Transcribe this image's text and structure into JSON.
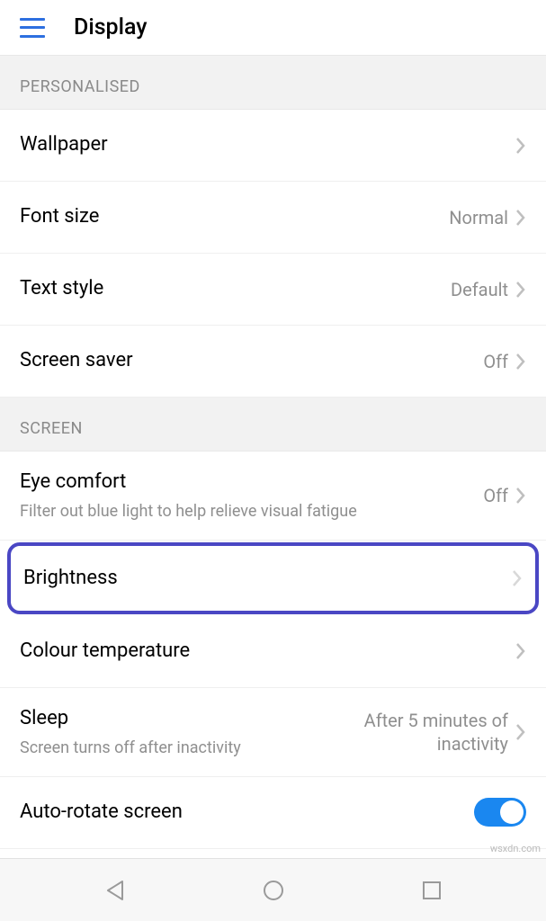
{
  "header": {
    "title": "Display"
  },
  "sections": {
    "personalised": {
      "header": "PERSONALISED",
      "wallpaper": {
        "label": "Wallpaper"
      },
      "font_size": {
        "label": "Font size",
        "value": "Normal"
      },
      "text_style": {
        "label": "Text style",
        "value": "Default"
      },
      "screen_saver": {
        "label": "Screen saver",
        "value": "Off"
      }
    },
    "screen": {
      "header": "SCREEN",
      "eye_comfort": {
        "label": "Eye comfort",
        "sublabel": "Filter out blue light to help relieve visual fatigue",
        "value": "Off"
      },
      "brightness": {
        "label": "Brightness"
      },
      "colour_temperature": {
        "label": "Colour temperature"
      },
      "sleep": {
        "label": "Sleep",
        "sublabel": "Screen turns off after inactivity",
        "value": "After 5 minutes of inactivity"
      },
      "auto_rotate": {
        "label": "Auto-rotate screen",
        "enabled": true
      }
    }
  },
  "watermark": "wsxdn.com"
}
